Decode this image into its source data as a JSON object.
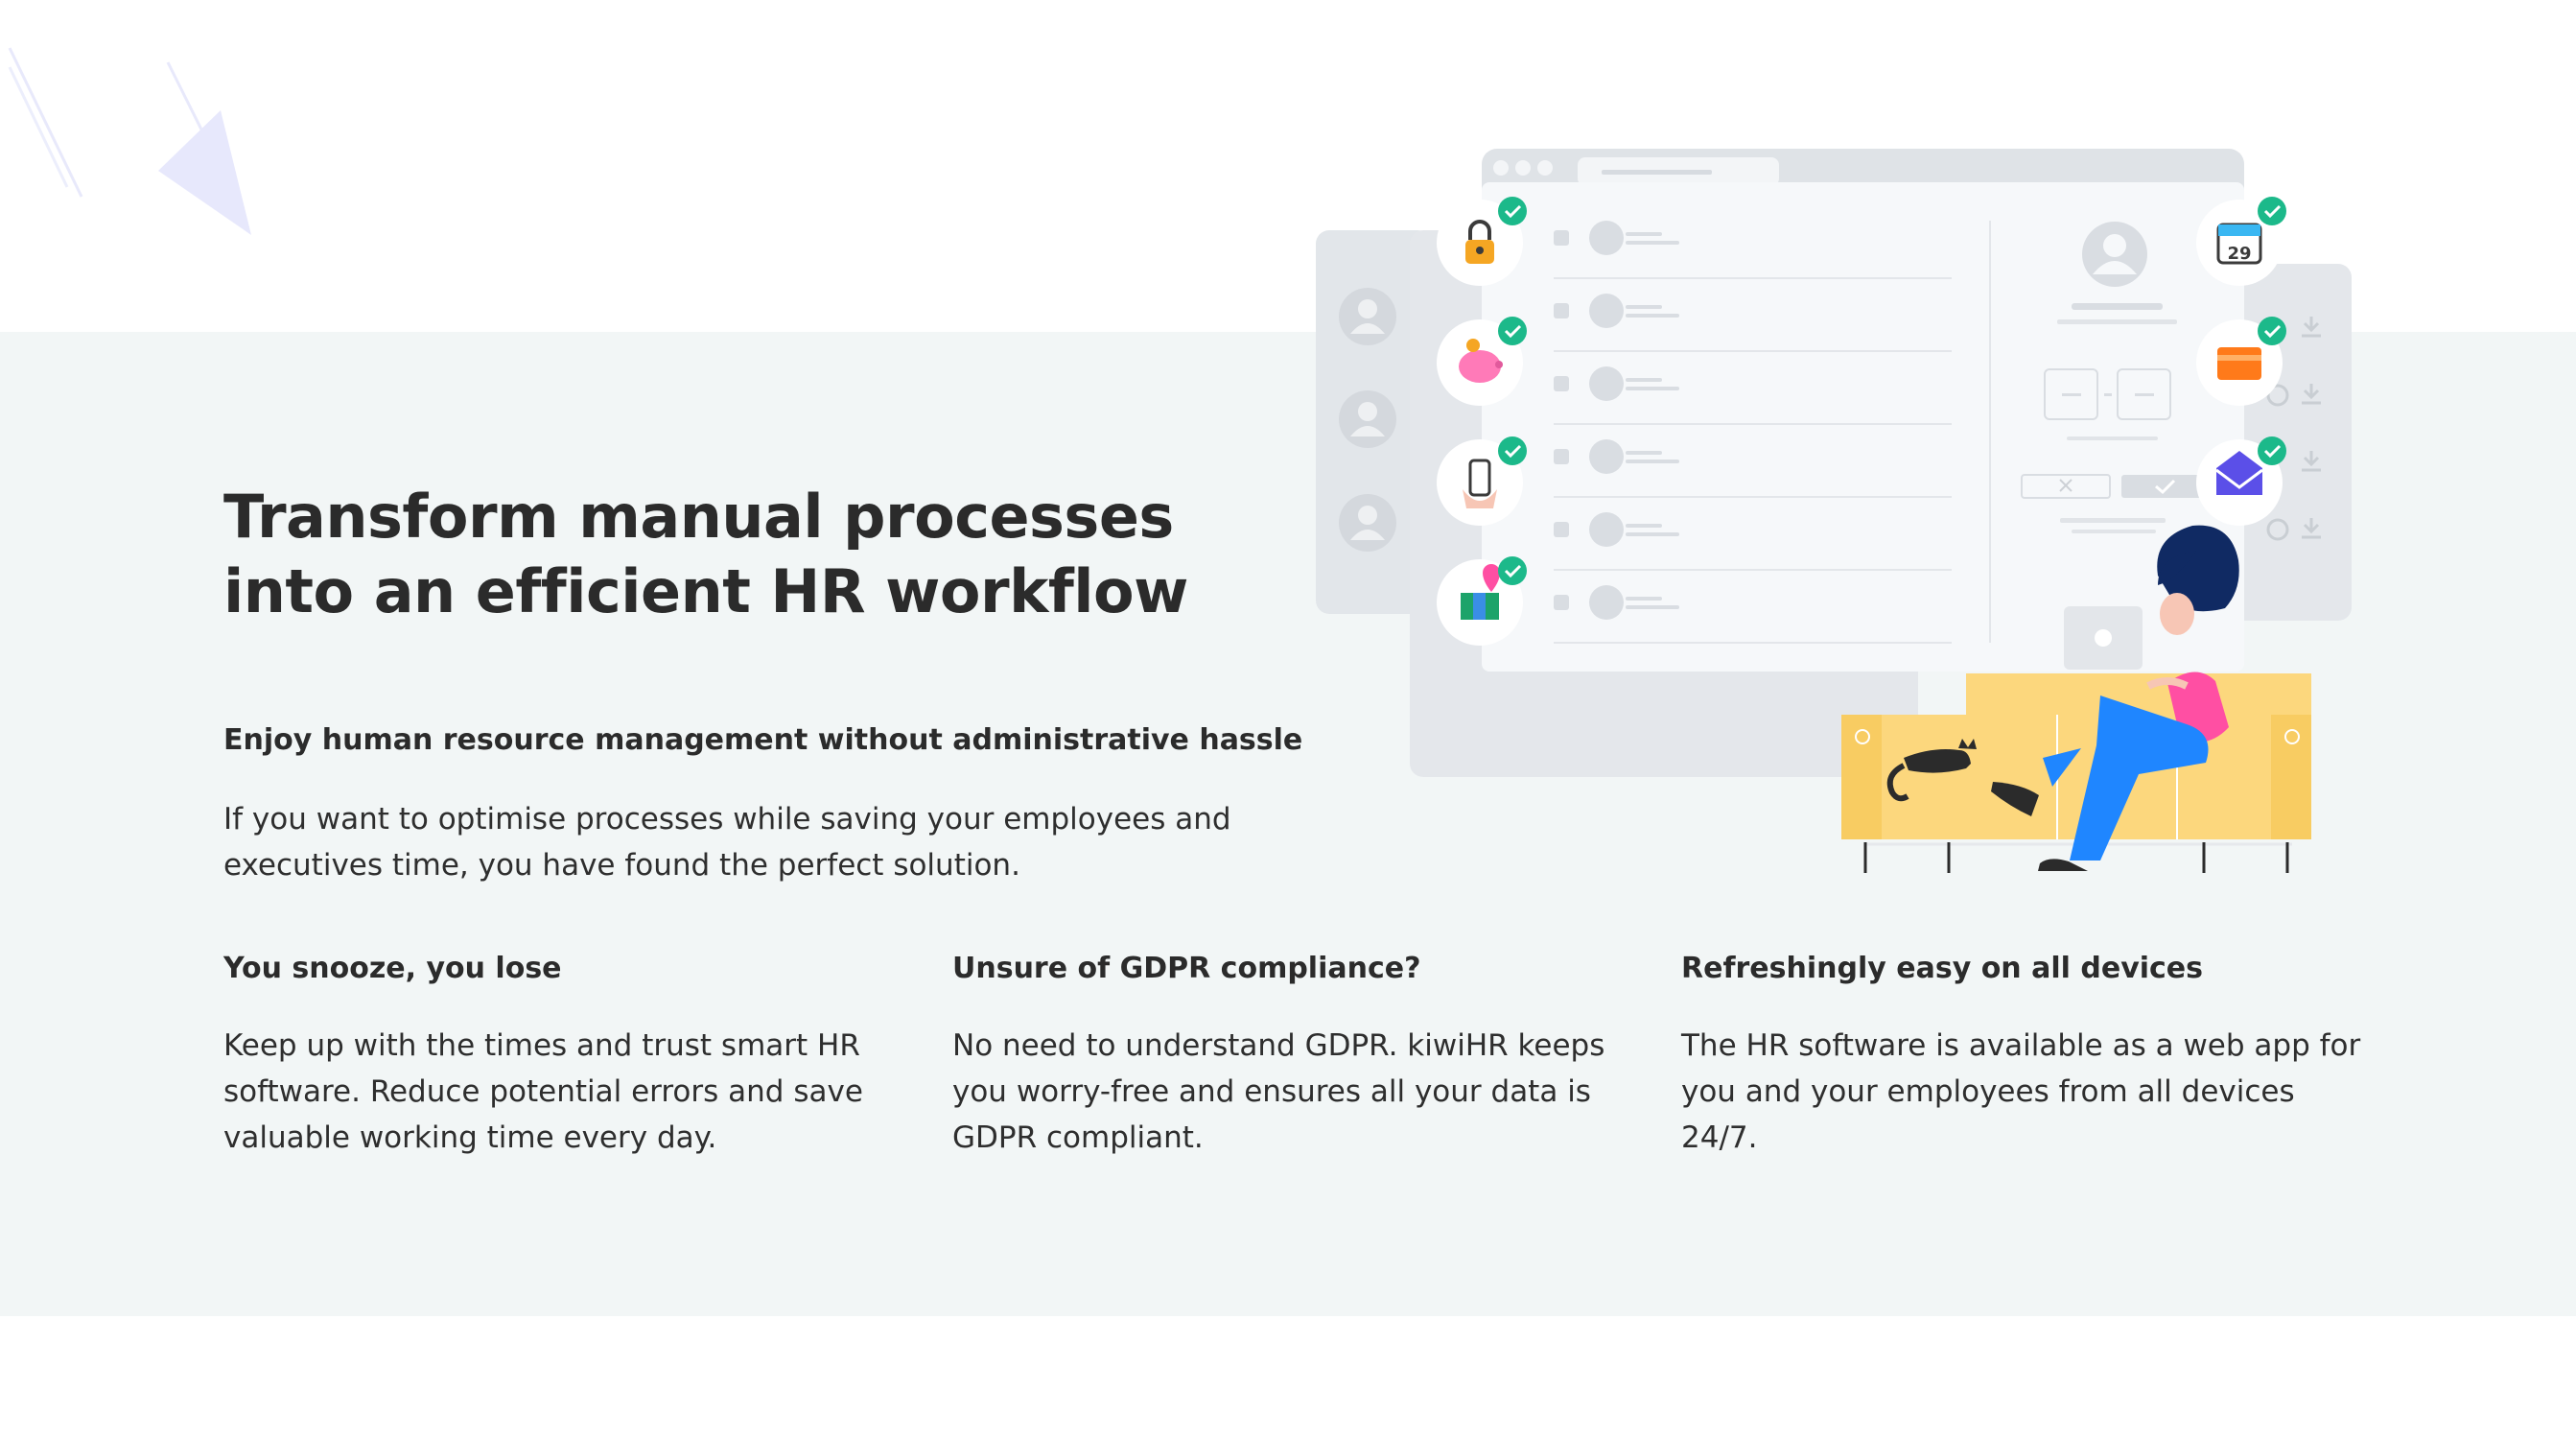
{
  "hero": {
    "title": "Transform manual processes into an efficient HR workflow",
    "subtitle": "Enjoy human resource management without administrative hassle",
    "intro": "If you want to optimise processes while saving your employees and executives time, you have found the perfect solution."
  },
  "features": [
    {
      "title": "You snooze, you lose",
      "text": "Keep up with the times and trust smart HR software. Reduce potential errors and save valuable working time every day."
    },
    {
      "title": "Unsure of GDPR compliance?",
      "text": "No need to understand GDPR. kiwiHR keeps you worry-free and ensures all your data is GDPR compliant."
    },
    {
      "title": "Refreshingly easy on all devices",
      "text": "The HR software is available as a web app for you and your employees from all devices 24/7."
    }
  ],
  "illustration": {
    "calendar_day": "29",
    "icons": [
      "lock-icon",
      "piggy-bank-icon",
      "phone-hand-icon",
      "map-pin-icon",
      "calendar-icon",
      "folder-icon",
      "envelope-icon"
    ]
  },
  "colors": {
    "band_background": "#f2f6f6",
    "text": "#2b2b2b",
    "check_badge": "#1cb98a",
    "sofa": "#fcd77d",
    "accent_pink": "#ff4fa3",
    "accent_blue": "#1f86ff",
    "deco_violet": "#e7e8fc"
  }
}
